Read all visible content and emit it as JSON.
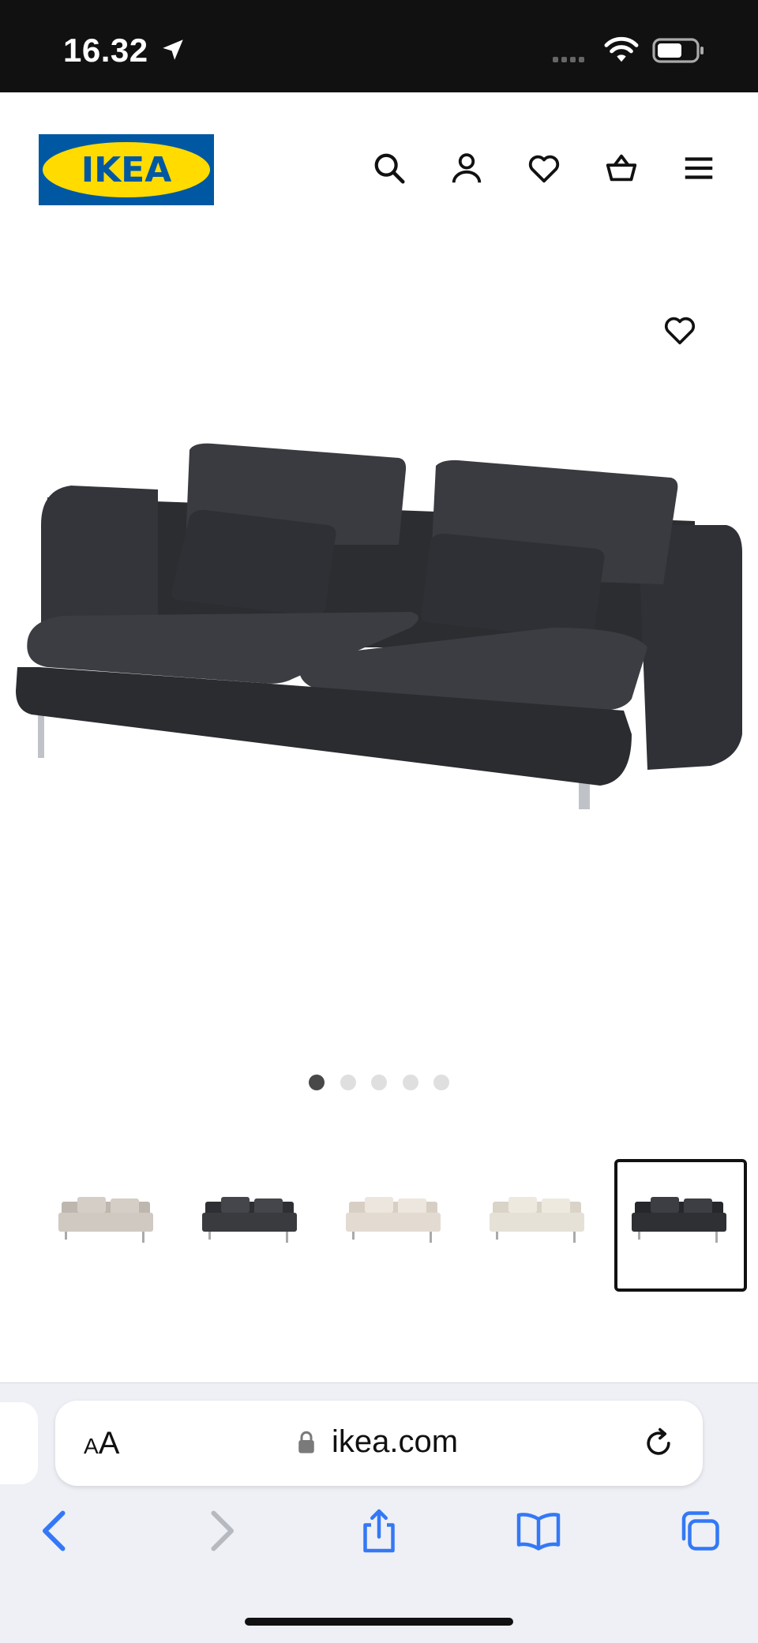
{
  "status_bar": {
    "time": "16.32",
    "icons": [
      "location-arrow-icon",
      "cellular-signal-icon",
      "wifi-icon",
      "battery-icon"
    ]
  },
  "header": {
    "logo_text": "IKEA",
    "icons": [
      "search-icon",
      "account-icon",
      "favorites-heart-icon",
      "shopping-basket-icon",
      "menu-hamburger-icon"
    ]
  },
  "product": {
    "image": "sofa-dark-grey",
    "favorite_icon": "heart-outline-icon",
    "carousel": {
      "total": 5,
      "active_index": 0
    },
    "color_variants": [
      {
        "name": "light-grey-beige",
        "color": "#cfc9c1",
        "selected": false
      },
      {
        "name": "dark-grey",
        "color": "#3a3b3f",
        "selected": false
      },
      {
        "name": "beige",
        "color": "#e3dbd1",
        "selected": false
      },
      {
        "name": "cream",
        "color": "#e6e1d6",
        "selected": false
      },
      {
        "name": "dark-grey",
        "color": "#2f3034",
        "selected": true
      }
    ]
  },
  "browser": {
    "text_size_label": "AA",
    "url": "ikea.com",
    "toolbar_icons": [
      "back-icon",
      "forward-icon",
      "share-icon",
      "bookmarks-icon",
      "tabs-icon"
    ]
  },
  "colors": {
    "ikea_blue": "#0058A3",
    "ikea_yellow": "#FFDB00",
    "ios_blue": "#3478F6",
    "statusbar_bg": "#111111"
  }
}
